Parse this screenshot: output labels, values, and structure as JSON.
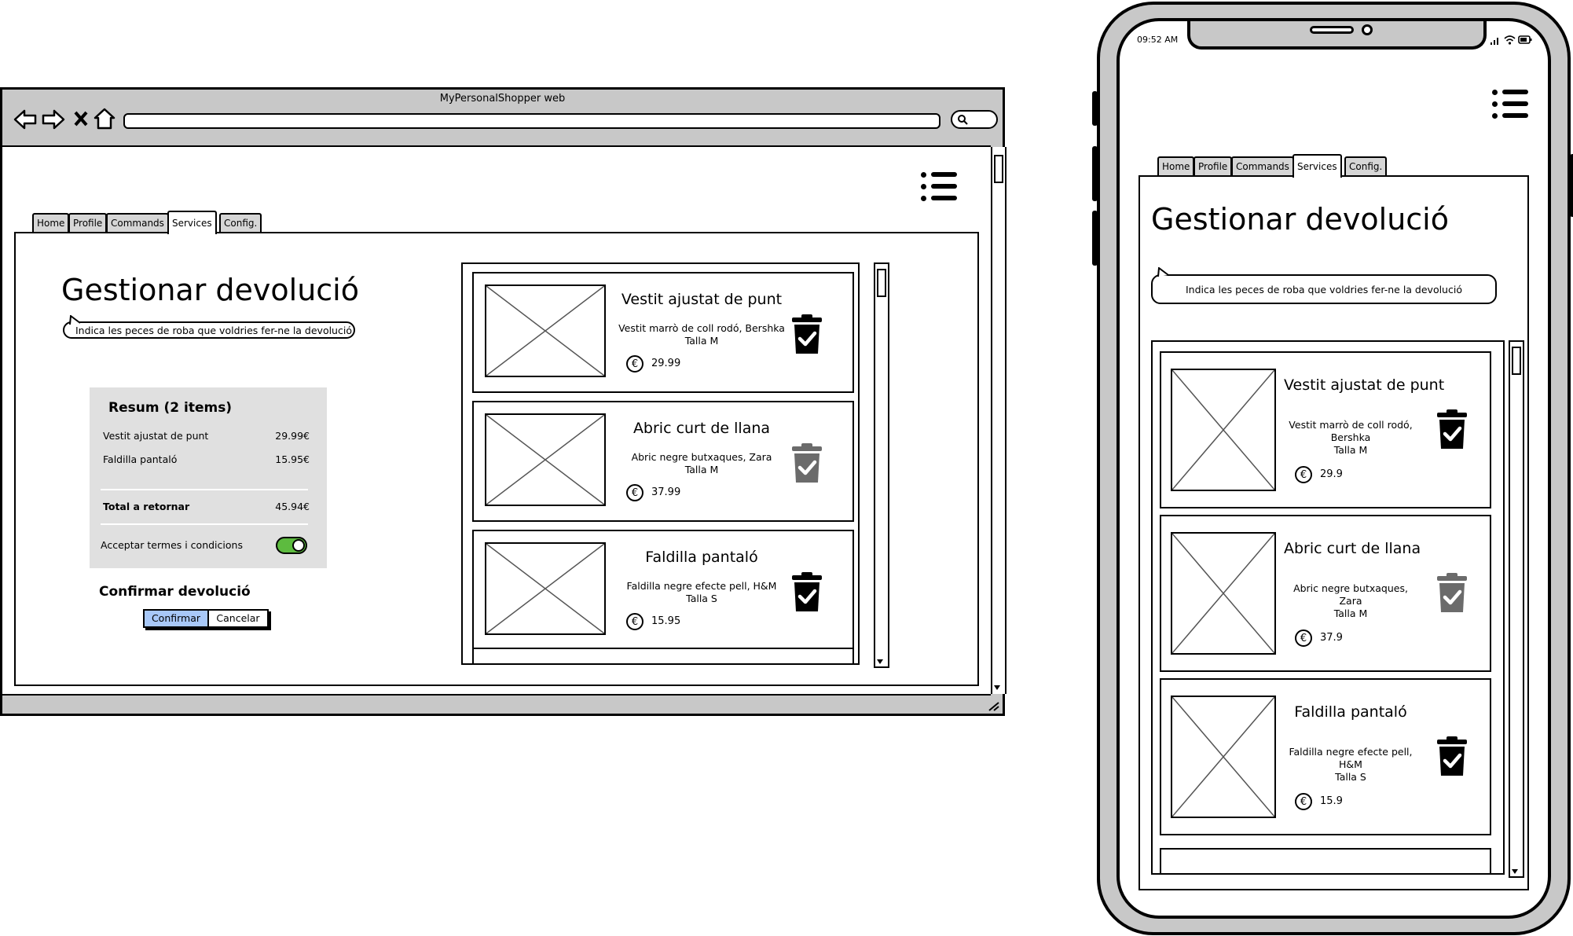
{
  "browser": {
    "window_title": "MyPersonalShopper web",
    "nav": {
      "back_icon": "back-arrow-icon",
      "forward_icon": "forward-arrow-icon",
      "stop_icon": "close-icon",
      "home_icon": "home-icon",
      "search_icon": "search-icon"
    },
    "menu_icon": "hamburger-menu-icon",
    "tabs": [
      {
        "label": "Home",
        "active": false
      },
      {
        "label": "Profile",
        "active": false
      },
      {
        "label": "Commands",
        "active": false
      },
      {
        "label": "Services",
        "active": true
      },
      {
        "label": "Config.",
        "active": false
      }
    ],
    "page_title": "Gestionar devolució",
    "hint": "Indica les peces de roba que voldries fer-ne la devolució",
    "summary": {
      "title": "Resum (2 items)",
      "items": [
        {
          "name": "Vestit ajustat de punt",
          "price": "29.99€"
        },
        {
          "name": "Faldilla pantaló",
          "price": "15.95€"
        }
      ],
      "total_label": "Total a retornar",
      "total_value": "45.94€",
      "terms_label": "Acceptar termes i condicions",
      "terms_accepted": true
    },
    "confirm_heading": "Confirmar devolució",
    "confirm_button": "Confirmar",
    "cancel_button": "Cancelar",
    "products": [
      {
        "title": "Vestit ajustat de punt",
        "desc": "Vestit marrò de coll rodó, Bershka",
        "size": "Talla M",
        "price": "29.99",
        "selected": true,
        "currency_icon": "euro-icon",
        "action_icon": "trash-check-icon"
      },
      {
        "title": "Abric curt de llana",
        "desc": "Abric negre butxaques, Zara",
        "size": "Talla M",
        "price": "37.99",
        "selected": false,
        "currency_icon": "euro-icon",
        "action_icon": "trash-check-icon"
      },
      {
        "title": "Faldilla pantaló",
        "desc": "Faldilla negre efecte pell, H&M",
        "size": "Talla S",
        "price": "15.95",
        "selected": true,
        "currency_icon": "euro-icon",
        "action_icon": "trash-check-icon"
      }
    ]
  },
  "mobile": {
    "time": "09:52 AM",
    "status_icons": [
      "signal-icon",
      "wifi-icon",
      "battery-icon"
    ],
    "menu_icon": "hamburger-menu-icon",
    "tabs": [
      {
        "label": "Home",
        "active": false
      },
      {
        "label": "Profile",
        "active": false
      },
      {
        "label": "Commands",
        "active": false
      },
      {
        "label": "Services",
        "active": true
      },
      {
        "label": "Config.",
        "active": false
      }
    ],
    "page_title": "Gestionar devolució",
    "hint": "Indica les peces de roba que voldries fer-ne la devolució",
    "products": [
      {
        "title": "Vestit ajustat de punt",
        "desc": "Vestit marrò de coll rodó, Bershka",
        "size": "Talla M",
        "price": "29.9",
        "selected": true
      },
      {
        "title": "Abric curt de llana",
        "desc": "Abric negre butxaques, Zara",
        "size": "Talla M",
        "price": "37.9",
        "selected": false
      },
      {
        "title": "Faldilla pantaló",
        "desc": "Faldilla negre efecte pell, H&M",
        "size": "Talla S",
        "price": "15.9",
        "selected": true
      }
    ]
  },
  "colors": {
    "chrome_gray": "#c8c8c8",
    "panel_gray": "#e0e0e0",
    "confirm_blue": "#a8c8f8",
    "toggle_green": "#5dbb3f",
    "selected_icon": "#000000",
    "unselected_icon": "#6b6b6b"
  }
}
